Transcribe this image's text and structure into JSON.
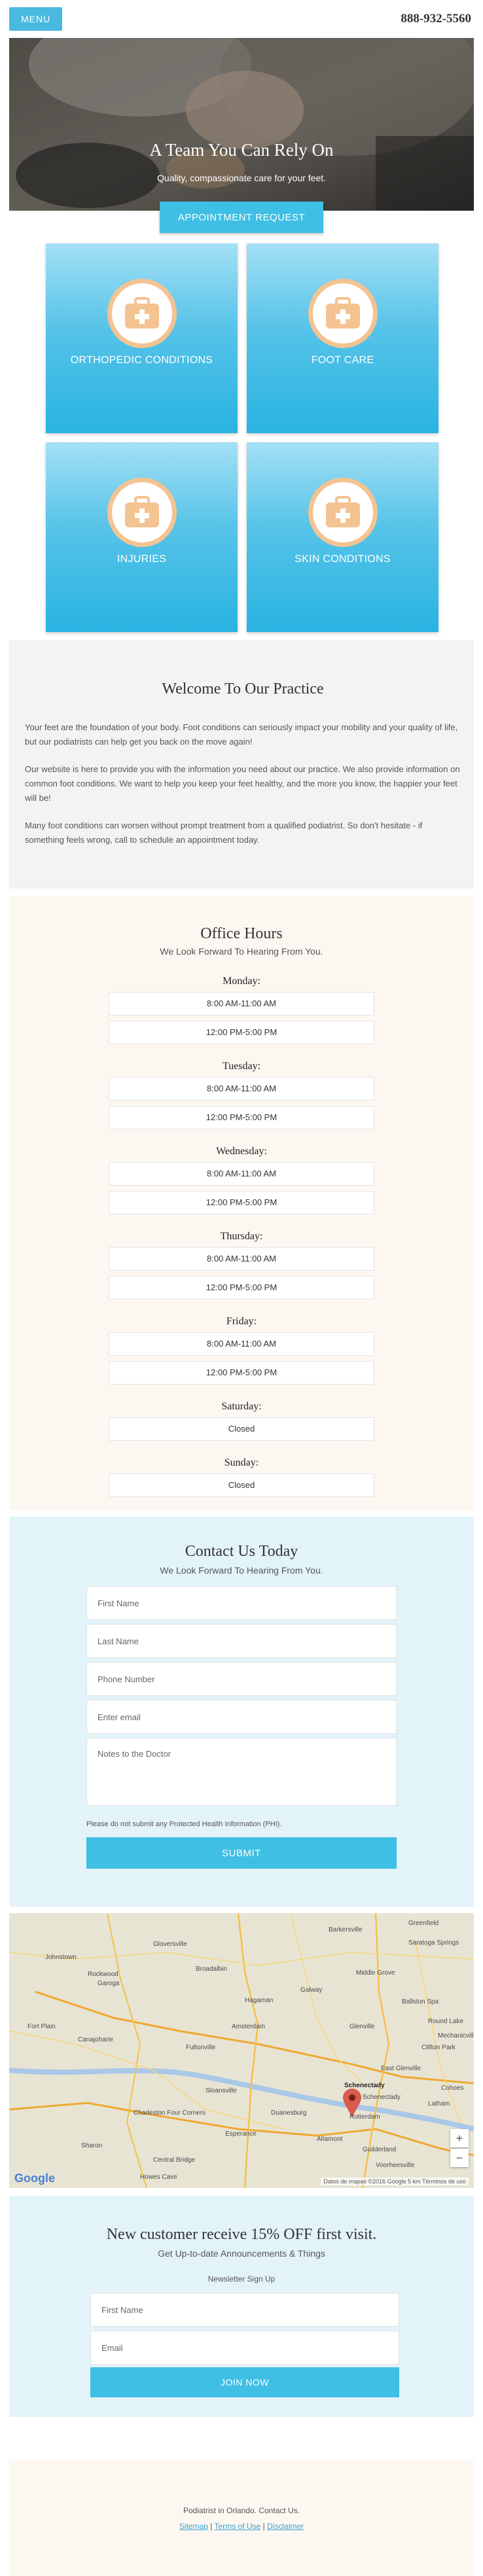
{
  "header": {
    "menu_label": "MENU",
    "phone": "888-932-5560"
  },
  "hero": {
    "title": "A Team You Can Rely On",
    "subtitle": "Quality, compassionate care for your feet.",
    "cta_label": "APPOINTMENT REQUEST"
  },
  "tiles": [
    {
      "label": "ORTHOPEDIC CONDITIONS",
      "icon": "medical-kit-icon"
    },
    {
      "label": "FOOT CARE",
      "icon": "medical-kit-icon"
    },
    {
      "label": "INJURIES",
      "icon": "medical-kit-icon"
    },
    {
      "label": "SKIN CONDITIONS",
      "icon": "medical-kit-icon"
    }
  ],
  "welcome": {
    "title": "Welcome To Our Practice",
    "paragraphs": [
      "Your feet are the foundation of your body. Foot conditions can seriously impact your mobility and your quality of life, but our podiatrists can help get you back on the move again!",
      "Our website is here to provide you with the information you need about our practice. We also provide information on common foot conditions. We want to help you keep your feet healthy, and the more you know, the happier your feet will be!",
      "Many foot conditions can worsen without prompt treatment from a qualified podiatrist. So don't hesitate - if something feels wrong, call to schedule an appointment today."
    ]
  },
  "hours": {
    "title": "Office Hours",
    "subtitle": "We Look Forward To Hearing From You.",
    "days": [
      {
        "name": "Monday:",
        "slots": [
          "8:00 AM-11:00 AM",
          "12:00 PM-5:00 PM"
        ]
      },
      {
        "name": "Tuesday:",
        "slots": [
          "8:00 AM-11:00 AM",
          "12:00 PM-5:00 PM"
        ]
      },
      {
        "name": "Wednesday:",
        "slots": [
          "8:00 AM-11:00 AM",
          "12:00 PM-5:00 PM"
        ]
      },
      {
        "name": "Thursday:",
        "slots": [
          "8:00 AM-11:00 AM",
          "12:00 PM-5:00 PM"
        ]
      },
      {
        "name": "Friday:",
        "slots": [
          "8:00 AM-11:00 AM",
          "12:00 PM-5:00 PM"
        ]
      },
      {
        "name": "Saturday:",
        "slots": [
          "Closed"
        ]
      },
      {
        "name": "Sunday:",
        "slots": [
          "Closed"
        ]
      }
    ]
  },
  "contact": {
    "title": "Contact Us Today",
    "subtitle": "We Look Forward To Hearing From You.",
    "first_name_placeholder": "First Name",
    "last_name_placeholder": "Last Name",
    "phone_placeholder": "Phone Number",
    "email_placeholder": "Enter email",
    "notes_placeholder": "Notes to the Doctor",
    "phi_notice": "Please do not submit any Protected Health Information (PHI).",
    "submit_label": "SUBMIT"
  },
  "map": {
    "places": [
      "Johnstown",
      "Gloversville",
      "Rockwood",
      "Garoga",
      "Broadalbin",
      "Barkersville",
      "Greenfield",
      "Saratoga Springs",
      "Middle Grove",
      "Galway",
      "Hagaman",
      "Amsterdam",
      "Ballston Spa",
      "Round Lake",
      "Fort Plain",
      "Canajoharie",
      "Fultonville",
      "Glenville",
      "East Glenville",
      "Schenectady",
      "Rotterdam",
      "Charleston Four Corners",
      "Sharon",
      "Esperance",
      "Central Bridge",
      "Howes Cave",
      "Altamont",
      "Guilderland",
      "Voorheesville",
      "Latham",
      "Cohoes",
      "Clifton Park",
      "Mechanicville",
      "Duanesburg",
      "Sloansville"
    ],
    "marker_label": "Schenectady",
    "attribution": "Datos de mapas ©2016 Google   5 km   Términos de uso",
    "google_label": "Google"
  },
  "newsletter": {
    "title": "New customer receive 15% OFF first visit.",
    "subtitle": "Get Up-to-date Announcements & Things",
    "label": "Newsletter Sign Up",
    "first_name_placeholder": "First Name",
    "email_placeholder": "Email",
    "join_label": "JOIN NOW"
  },
  "footer": {
    "line": "Podiatrist in Orlando. Contact Us.",
    "links": [
      "Sitemap",
      "Terms of Use",
      "Disclaimer"
    ],
    "separator": "|"
  },
  "colors": {
    "accent": "#3fbfe3",
    "tile_top": "#a4e0f5",
    "tile_bottom": "#29b3e2",
    "icon_ring": "#f4c392",
    "icon_fill": "#f4c392"
  }
}
